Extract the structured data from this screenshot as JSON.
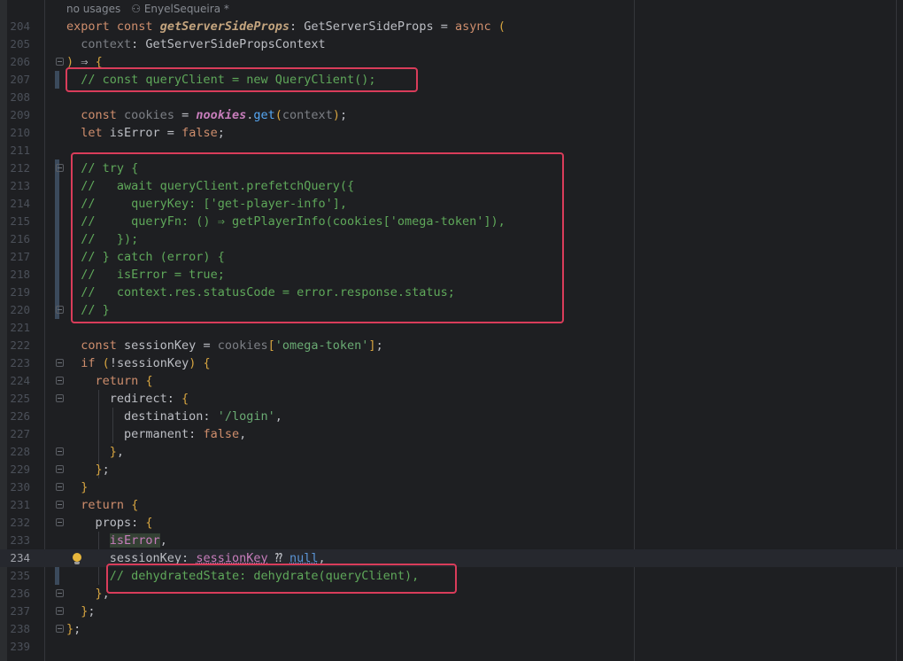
{
  "inlay": {
    "usages": "no usages",
    "author": "EnyelSequeira *"
  },
  "lines": [
    {
      "n": "204",
      "text": "export const getServerSideProps: GetServerSideProps = async ("
    },
    {
      "n": "205",
      "text": "  context: GetServerSidePropsContext"
    },
    {
      "n": "206",
      "text": ") => {"
    },
    {
      "n": "207",
      "text": "  // const queryClient = new QueryClient();"
    },
    {
      "n": "208",
      "text": ""
    },
    {
      "n": "209",
      "text": "  const cookies = nookies.get(context);"
    },
    {
      "n": "210",
      "text": "  let isError = false;"
    },
    {
      "n": "211",
      "text": ""
    },
    {
      "n": "212",
      "text": "  // try {"
    },
    {
      "n": "213",
      "text": "  //   await queryClient.prefetchQuery({"
    },
    {
      "n": "214",
      "text": "  //     queryKey: ['get-player-info'],"
    },
    {
      "n": "215",
      "text": "  //     queryFn: () => getPlayerInfo(cookies['omega-token']),"
    },
    {
      "n": "216",
      "text": "  //   });"
    },
    {
      "n": "217",
      "text": "  // } catch (error) {"
    },
    {
      "n": "218",
      "text": "  //   isError = true;"
    },
    {
      "n": "219",
      "text": "  //   context.res.statusCode = error.response.status;"
    },
    {
      "n": "220",
      "text": "  // }"
    },
    {
      "n": "221",
      "text": ""
    },
    {
      "n": "222",
      "text": "  const sessionKey = cookies['omega-token'];"
    },
    {
      "n": "223",
      "text": "  if (!sessionKey) {"
    },
    {
      "n": "224",
      "text": "    return {"
    },
    {
      "n": "225",
      "text": "      redirect: {"
    },
    {
      "n": "226",
      "text": "        destination: '/login',"
    },
    {
      "n": "227",
      "text": "        permanent: false,"
    },
    {
      "n": "228",
      "text": "      },"
    },
    {
      "n": "229",
      "text": "    };"
    },
    {
      "n": "230",
      "text": "  }"
    },
    {
      "n": "231",
      "text": "  return {"
    },
    {
      "n": "232",
      "text": "    props: {"
    },
    {
      "n": "233",
      "text": "      isError,"
    },
    {
      "n": "234",
      "text": "      sessionKey: sessionKey ?? null,"
    },
    {
      "n": "235",
      "text": "      // dehydratedState: dehydrate(queryClient),"
    },
    {
      "n": "236",
      "text": "    },"
    },
    {
      "n": "237",
      "text": "  };"
    },
    {
      "n": "238",
      "text": "};"
    },
    {
      "n": "239",
      "text": ""
    }
  ],
  "current_line": "234",
  "colors": {
    "background": "#1e1f22",
    "highlight_box": "#d93c5a",
    "bulb": "#e8b73c"
  },
  "icons": {
    "intention": "lightbulb-icon",
    "fold": "fold-marker-icon"
  }
}
